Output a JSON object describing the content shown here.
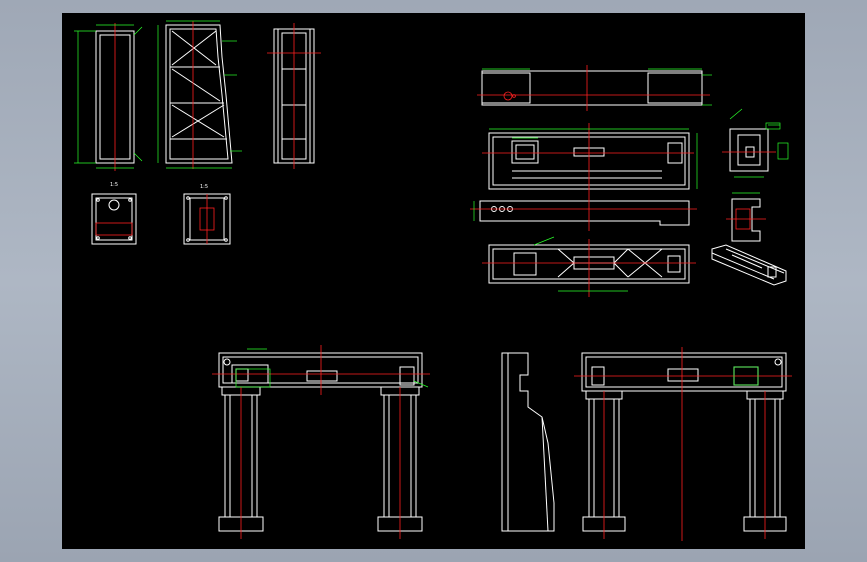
{
  "colors": {
    "outer_background": "#a7b0bd",
    "canvas_background": "#000000",
    "outline": "#ffffff",
    "centerline": "#ff2020",
    "dimension": "#2aff2a"
  },
  "labels": {
    "section_a": "1:5",
    "section_b": "1:5"
  }
}
